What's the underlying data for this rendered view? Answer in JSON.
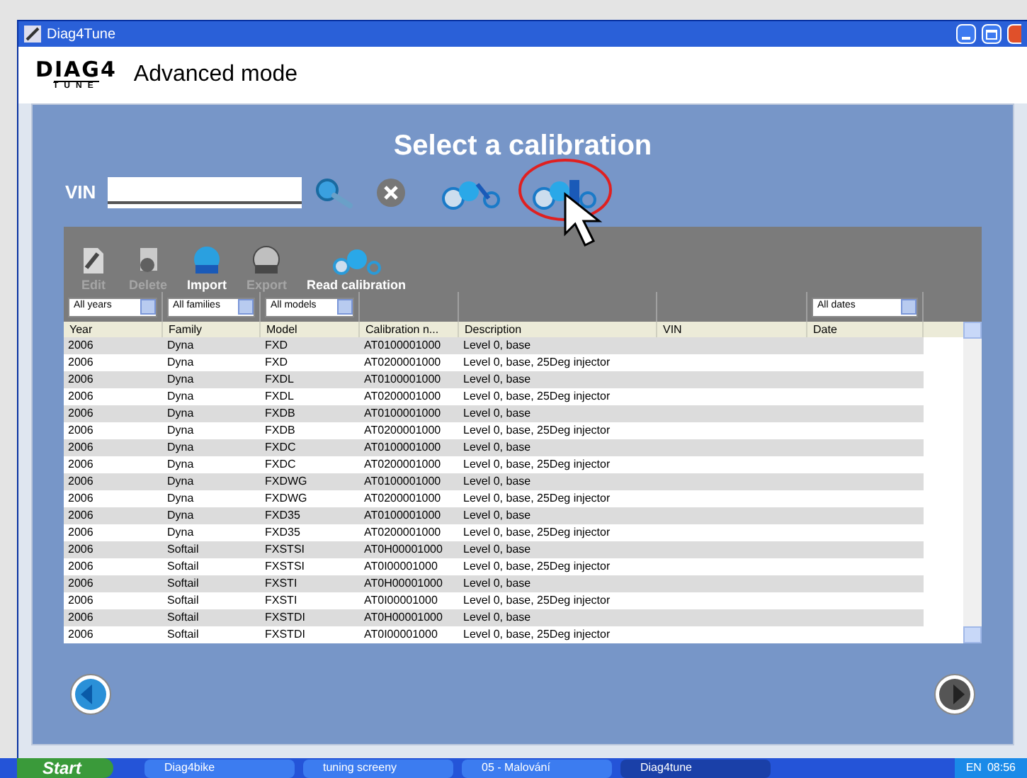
{
  "window": {
    "title": "Diag4Tune"
  },
  "header": {
    "logo_top": "DIAG4",
    "logo_bottom": "TUNE",
    "mode": "Advanced mode"
  },
  "heading": "Select a calibration",
  "vin": {
    "label": "VIN"
  },
  "toolbar": [
    {
      "label": "Edit",
      "disabled": true,
      "kind": "edit"
    },
    {
      "label": "Delete",
      "disabled": true,
      "kind": "delete"
    },
    {
      "label": "Import",
      "disabled": false,
      "kind": "import"
    },
    {
      "label": "Export",
      "disabled": true,
      "kind": "export"
    },
    {
      "label": "Read calibration",
      "disabled": false,
      "kind": "read"
    }
  ],
  "filters": [
    "All years",
    "All families",
    "All models",
    "All dates"
  ],
  "table": {
    "columns": [
      "Year",
      "Family",
      "Model",
      "Calibration n...",
      "Description",
      "VIN",
      "Date"
    ],
    "rows": [
      [
        "2006",
        "Dyna",
        "FXD",
        "AT0100001000",
        "Level 0, base"
      ],
      [
        "2006",
        "Dyna",
        "FXD",
        "AT0200001000",
        "Level 0, base, 25Deg injector"
      ],
      [
        "2006",
        "Dyna",
        "FXDL",
        "AT0100001000",
        "Level 0, base"
      ],
      [
        "2006",
        "Dyna",
        "FXDL",
        "AT0200001000",
        "Level 0, base, 25Deg injector"
      ],
      [
        "2006",
        "Dyna",
        "FXDB",
        "AT0100001000",
        "Level 0, base"
      ],
      [
        "2006",
        "Dyna",
        "FXDB",
        "AT0200001000",
        "Level 0, base, 25Deg injector"
      ],
      [
        "2006",
        "Dyna",
        "FXDC",
        "AT0100001000",
        "Level 0, base"
      ],
      [
        "2006",
        "Dyna",
        "FXDC",
        "AT0200001000",
        "Level 0, base, 25Deg injector"
      ],
      [
        "2006",
        "Dyna",
        "FXDWG",
        "AT0100001000",
        "Level 0, base"
      ],
      [
        "2006",
        "Dyna",
        "FXDWG",
        "AT0200001000",
        "Level 0, base, 25Deg injector"
      ],
      [
        "2006",
        "Dyna",
        "FXD35",
        "AT0100001000",
        "Level 0, base"
      ],
      [
        "2006",
        "Dyna",
        "FXD35",
        "AT0200001000",
        "Level 0, base, 25Deg injector"
      ],
      [
        "2006",
        "Softail",
        "FXSTSI",
        "AT0H00001000",
        "Level 0, base"
      ],
      [
        "2006",
        "Softail",
        "FXSTSI",
        "AT0I00001000",
        "Level 0, base, 25Deg injector"
      ],
      [
        "2006",
        "Softail",
        "FXSTI",
        "AT0H00001000",
        "Level 0, base"
      ],
      [
        "2006",
        "Softail",
        "FXSTI",
        "AT0I00001000",
        "Level 0, base, 25Deg injector"
      ],
      [
        "2006",
        "Softail",
        "FXSTDI",
        "AT0H00001000",
        "Level 0, base"
      ],
      [
        "2006",
        "Softail",
        "FXSTDI",
        "AT0I00001000",
        "Level 0, base, 25Deg injector"
      ]
    ]
  },
  "taskbar": {
    "start": "Start",
    "items": [
      {
        "label": "Diag4bike",
        "selected": false
      },
      {
        "label": "tuning screeny",
        "selected": false
      },
      {
        "label": "05 - Malování",
        "selected": false
      },
      {
        "label": "Diag4tune",
        "selected": true
      }
    ],
    "language": "EN",
    "clock": "08:56"
  }
}
